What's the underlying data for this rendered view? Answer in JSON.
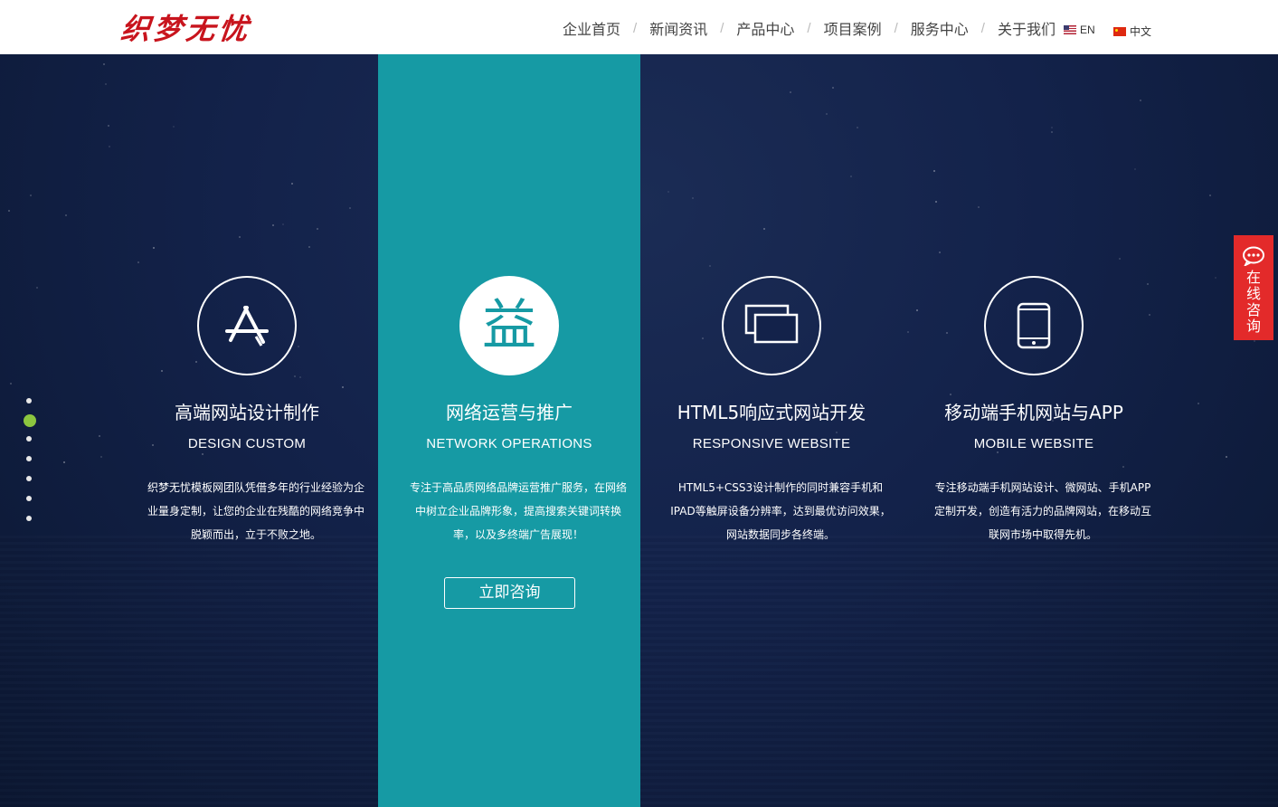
{
  "header": {
    "logo_text": "织梦无忧",
    "nav": [
      {
        "label": "企业首页"
      },
      {
        "label": "新闻资讯"
      },
      {
        "label": "产品中心"
      },
      {
        "label": "项目案例"
      },
      {
        "label": "服务中心"
      },
      {
        "label": "关于我们"
      }
    ],
    "lang_en": "EN",
    "lang_cn": "中文"
  },
  "hero": {
    "columns": [
      {
        "icon": "app-store-icon",
        "title": "高端网站设计制作",
        "subtitle": "DESIGN CUSTOM",
        "description": "织梦无忧模板网团队凭借多年的行业经验为企业量身定制，让您的企业在残酷的网络竞争中脱颖而出，立于不败之地。"
      },
      {
        "icon": "yi-character-icon",
        "icon_glyph": "益",
        "title": "网络运营与推广",
        "subtitle": "NETWORK OPERATIONS",
        "description": "专注于高品质网络品牌运营推广服务，在网络中树立企业品牌形象，提高搜索关键词转换率，以及多终端广告展现！",
        "button": "立即咨询"
      },
      {
        "icon": "responsive-windows-icon",
        "title": "HTML5响应式网站开发",
        "subtitle": "RESPONSIVE WEBSITE",
        "description": "HTML5+CSS3设计制作的同时兼容手机和IPAD等触屏设备分辨率，达到最优访问效果，网站数据同步各终端。"
      },
      {
        "icon": "mobile-phone-icon",
        "title": "移动端手机网站与APP",
        "subtitle": "MOBILE WEBSITE",
        "description": "专注移动端手机网站设计、微网站、手机APP定制开发，创造有活力的品牌网站，在移动互联网市场中取得先机。"
      }
    ],
    "active_column": 2
  },
  "pager": {
    "count": 7,
    "active_index": 2
  },
  "consult": {
    "label": "在线咨询",
    "icon": "chat-bubble-icon"
  },
  "colors": {
    "accent_teal": "#169aa4",
    "brand_red": "#c8141d",
    "consult_red": "#e32a2a",
    "active_dot": "#8cc63f",
    "background_navy": "#13224a"
  }
}
